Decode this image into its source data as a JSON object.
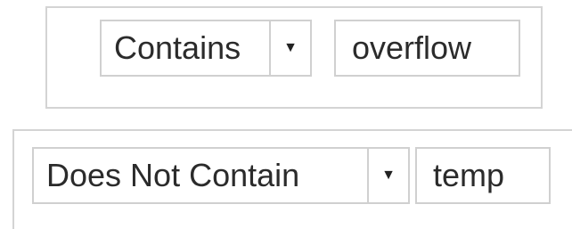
{
  "filters": [
    {
      "operator": "Contains",
      "dropdown_glyph": "▼",
      "value": "overflow"
    },
    {
      "operator": "Does Not Contain",
      "dropdown_glyph": "▼",
      "value": "temp"
    }
  ]
}
